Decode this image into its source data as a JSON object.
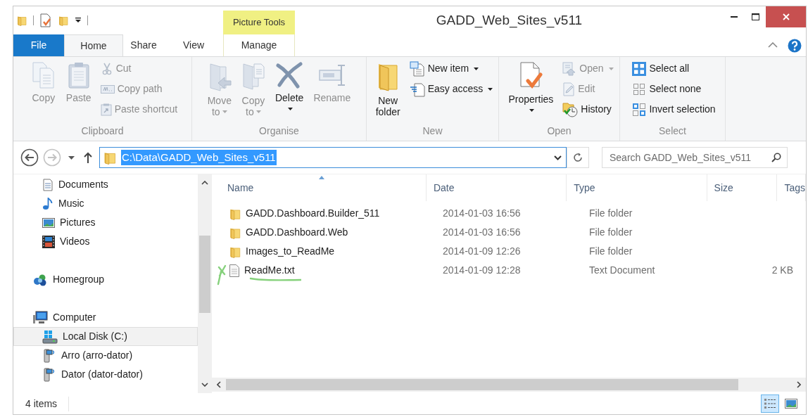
{
  "window": {
    "title": "GADD_Web_Sites_v511"
  },
  "contextual_tab_group": {
    "label": "Picture Tools"
  },
  "tabs": [
    {
      "label": "File",
      "kind": "file",
      "selected": false
    },
    {
      "label": "Home",
      "kind": "normal",
      "selected": true
    },
    {
      "label": "Share",
      "kind": "normal",
      "selected": false
    },
    {
      "label": "View",
      "kind": "normal",
      "selected": false
    },
    {
      "label": "Manage",
      "kind": "contextual",
      "selected": false
    }
  ],
  "ribbon": {
    "groups": [
      {
        "label": "Clipboard",
        "items": [
          {
            "label": "Copy",
            "kind": "large",
            "disabled": true,
            "dropdown": false
          },
          {
            "label": "Paste",
            "kind": "large",
            "disabled": true,
            "dropdown": false
          },
          {
            "label": "Cut",
            "kind": "small",
            "disabled": true,
            "dropdown": false
          },
          {
            "label": "Copy path",
            "kind": "small",
            "disabled": true,
            "dropdown": false
          },
          {
            "label": "Paste shortcut",
            "kind": "small",
            "disabled": true,
            "dropdown": false
          }
        ]
      },
      {
        "label": "Organise",
        "items": [
          {
            "label": "Move to",
            "kind": "large",
            "disabled": true,
            "dropdown": true
          },
          {
            "label": "Copy to",
            "kind": "large",
            "disabled": true,
            "dropdown": true
          },
          {
            "label": "Delete",
            "kind": "large",
            "disabled": false,
            "dropdown": true
          },
          {
            "label": "Rename",
            "kind": "large",
            "disabled": true,
            "dropdown": false
          }
        ]
      },
      {
        "label": "New",
        "items": [
          {
            "label": "New folder",
            "kind": "large",
            "disabled": false,
            "dropdown": false
          },
          {
            "label": "New item",
            "kind": "small",
            "disabled": false,
            "dropdown": true
          },
          {
            "label": "Easy access",
            "kind": "small",
            "disabled": false,
            "dropdown": true
          }
        ]
      },
      {
        "label": "Open",
        "items": [
          {
            "label": "Properties",
            "kind": "large",
            "disabled": false,
            "dropdown": true
          },
          {
            "label": "Open",
            "kind": "small",
            "disabled": true,
            "dropdown": true
          },
          {
            "label": "Edit",
            "kind": "small",
            "disabled": true,
            "dropdown": false
          },
          {
            "label": "History",
            "kind": "small",
            "disabled": false,
            "dropdown": false
          }
        ]
      },
      {
        "label": "Select",
        "items": [
          {
            "label": "Select all",
            "kind": "small",
            "disabled": false,
            "dropdown": false
          },
          {
            "label": "Select none",
            "kind": "small",
            "disabled": false,
            "dropdown": false
          },
          {
            "label": "Invert selection",
            "kind": "small",
            "disabled": false,
            "dropdown": false
          }
        ]
      }
    ]
  },
  "navigation": {
    "back": {
      "disabled": false
    },
    "forward": {
      "disabled": true
    }
  },
  "address_bar": {
    "path": "C:\\Data\\GADD_Web_Sites_v511",
    "selected": true
  },
  "search": {
    "placeholder": "Search GADD_Web_Sites_v511"
  },
  "navigation_pane": {
    "items": [
      {
        "children": [
          {
            "label": "Documents",
            "selected": false
          },
          {
            "label": "Music",
            "selected": false
          },
          {
            "label": "Pictures",
            "selected": false
          },
          {
            "label": "Videos",
            "selected": false
          }
        ]
      },
      {
        "label": "Homegroup",
        "selected": false
      },
      {
        "label": "Computer",
        "selected": false,
        "children": [
          {
            "label": "Local Disk (C:)",
            "selected": true
          },
          {
            "label": "Arro (arro-dator)",
            "selected": false
          },
          {
            "label": "Dator (dator-dator)",
            "selected": false
          }
        ]
      }
    ]
  },
  "file_list": {
    "columns": [
      {
        "label": "Name",
        "sorted": true
      },
      {
        "label": "Date",
        "sorted": false
      },
      {
        "label": "Type",
        "sorted": false
      },
      {
        "label": "Size",
        "sorted": false
      },
      {
        "label": "Tags",
        "sorted": false
      }
    ],
    "rows": [
      {
        "kind": "folder",
        "name": "GADD.Dashboard.Builder_511",
        "date": "2014-01-03 16:56",
        "type": "File folder"
      },
      {
        "kind": "folder",
        "name": "GADD.Dashboard.Web",
        "date": "2014-01-03 16:56",
        "type": "File folder"
      },
      {
        "kind": "folder",
        "name": "Images_to_ReadMe",
        "date": "2014-01-09 12:26",
        "type": "File folder"
      },
      {
        "kind": "file",
        "name": "ReadMe.txt",
        "date": "2014-01-09 12:28",
        "type": "Text Document",
        "size": "2 KB"
      }
    ]
  },
  "status_bar": {
    "item_count": "4 items",
    "views": [
      {
        "selected": true
      },
      {
        "selected": false
      }
    ]
  }
}
